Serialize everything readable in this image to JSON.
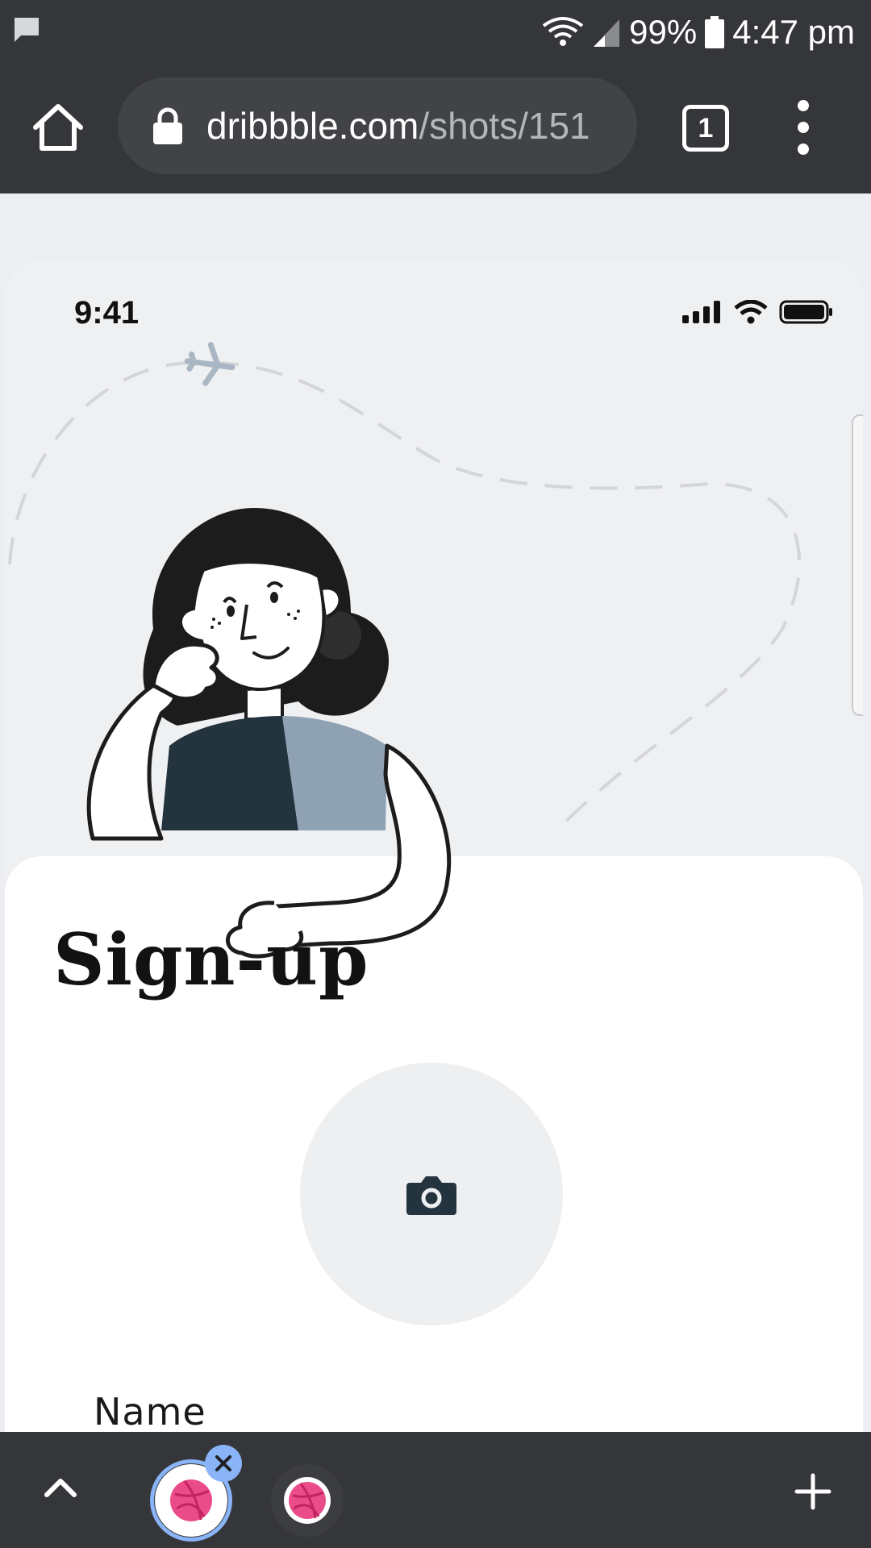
{
  "status_bar": {
    "battery": "99%",
    "time": "4:47 pm"
  },
  "toolbar": {
    "url_domain": "dribbble.com",
    "url_path": "/shots/151",
    "tab_count": "1"
  },
  "page": {
    "phone_time": "9:41",
    "title": "Sign-up",
    "name_label": "Name"
  },
  "colors": {
    "chrome_dark": "#35363a",
    "accent_blue": "#8ab4f8",
    "dribbble_pink": "#ea4c89",
    "shirt_navy": "#24343f",
    "shirt_gray": "#8fa2b3"
  }
}
